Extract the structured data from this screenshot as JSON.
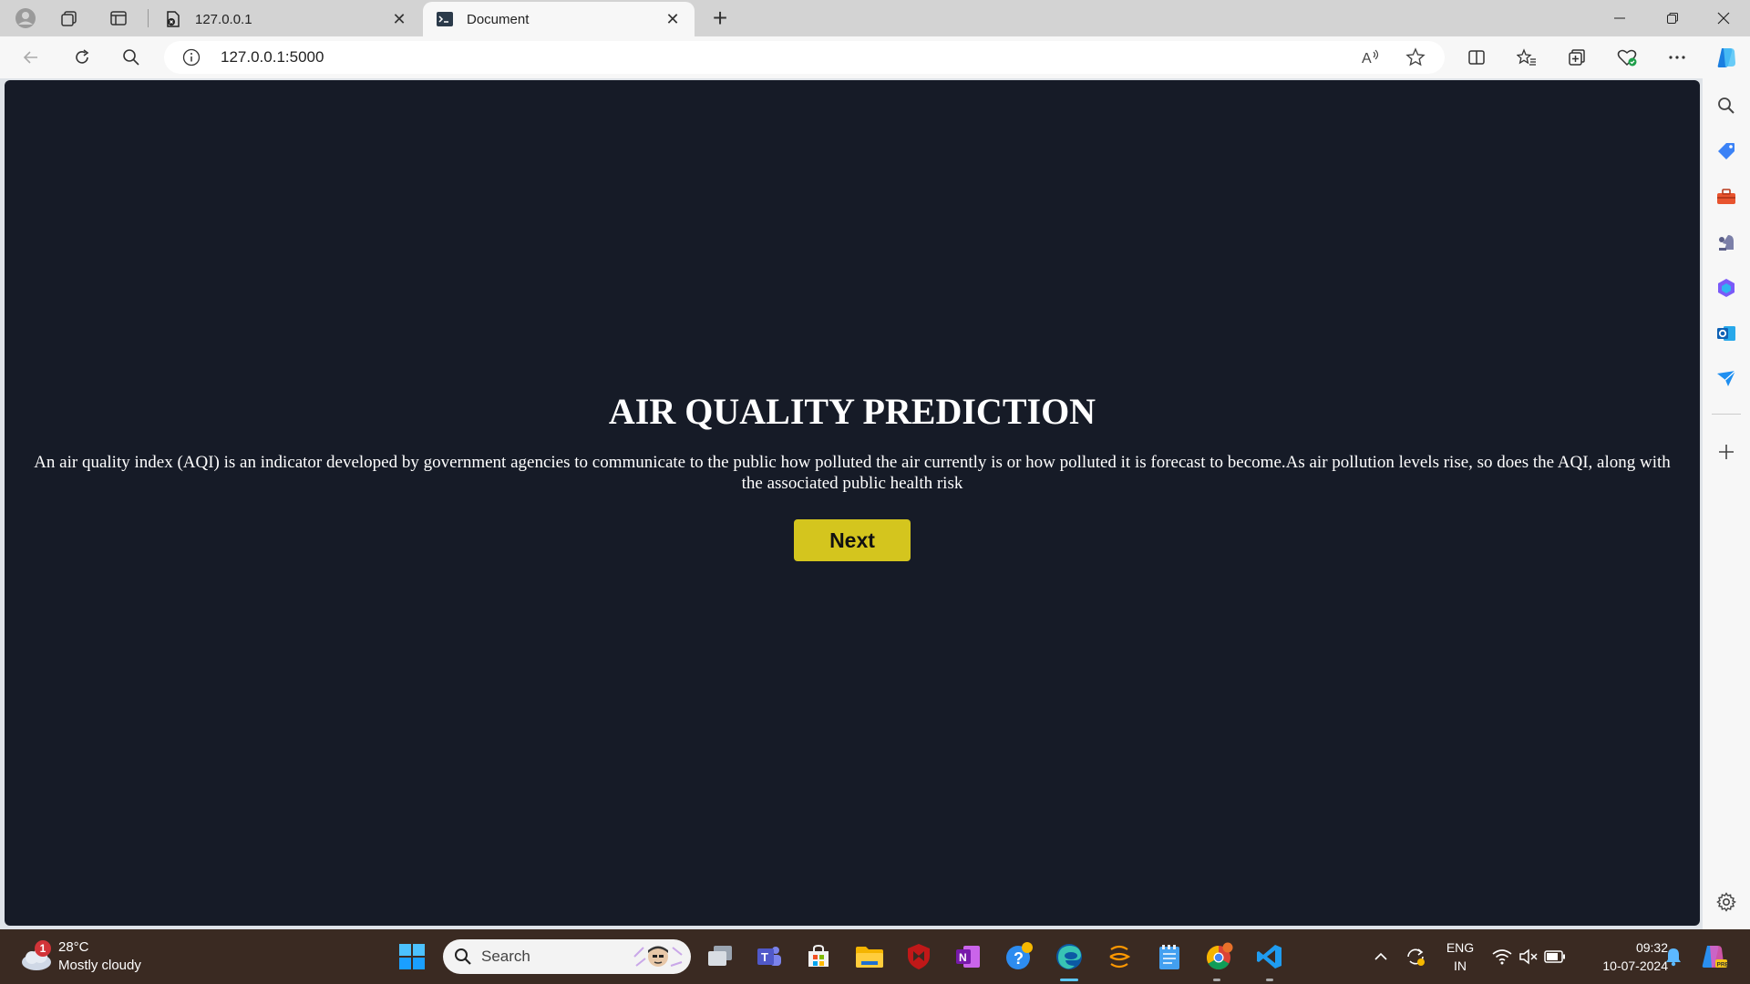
{
  "browser": {
    "tabs": [
      {
        "title": "127.0.0.1",
        "active": false
      },
      {
        "title": "Document",
        "active": true
      }
    ],
    "address": {
      "url": "127.0.0.1:5000"
    }
  },
  "page": {
    "heading": "AIR QUALITY PREDICTION",
    "description": "An air quality index (AQI) is an indicator developed by government agencies to communicate to the public how polluted the air currently is or how polluted it is forecast to become.As air pollution levels rise, so does the AQI, along with the associated public health risk",
    "next_label": "Next",
    "background_color": "#161b27",
    "button_color": "#d4c51e"
  },
  "taskbar": {
    "weather": {
      "temp": "28°C",
      "condition": "Mostly cloudy",
      "badge": "1"
    },
    "search_placeholder": "Search",
    "language": {
      "line1": "ENG",
      "line2": "IN"
    },
    "clock": {
      "time": "09:32",
      "date": "10-07-2024"
    }
  }
}
